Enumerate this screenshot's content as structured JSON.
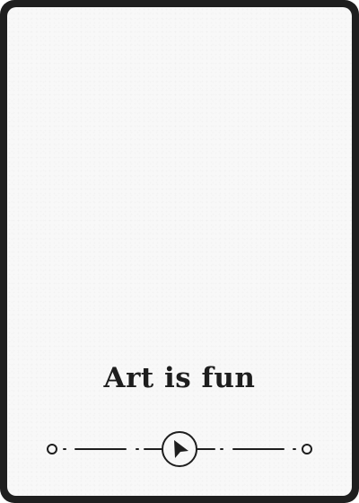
{
  "card": {
    "title": "Art is fun",
    "background_color": "#f8f8f8",
    "frame_color": "#1f1f1f",
    "text_color": "#1e1e1e"
  },
  "ornament": {
    "center_icon": "play-arrow-icon",
    "end_icon": "circle-icon"
  }
}
